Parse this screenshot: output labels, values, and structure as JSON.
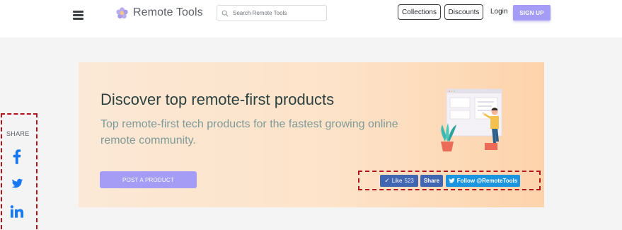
{
  "header": {
    "logo_text": "Remote Tools",
    "search_placeholder": "Search Remote Tools",
    "nav": {
      "collections": "Collections",
      "discounts": "Discounts",
      "login": "Login",
      "signup": "SIGN UP"
    }
  },
  "hero": {
    "title": "Discover top remote-first products",
    "subtitle": "Top remote-first tech products for the fastest growing online remote community.",
    "post_button": "POST A PRODUCT"
  },
  "social_buttons": {
    "like_label": "Like",
    "like_count": "523",
    "share_label": "Share",
    "follow_label": "Follow @RemoteTools"
  },
  "share_sidebar": {
    "label": "SHARE",
    "icons": [
      "facebook-icon",
      "twitter-icon",
      "linkedin-icon"
    ]
  },
  "colors": {
    "accent": "#a49cf5",
    "facebook": "#4267b2",
    "twitter": "#1b95e0",
    "share_icon_blue": "#1877f2",
    "annotation_red": "#b3141b",
    "hero_bg": "#fde3c9"
  }
}
